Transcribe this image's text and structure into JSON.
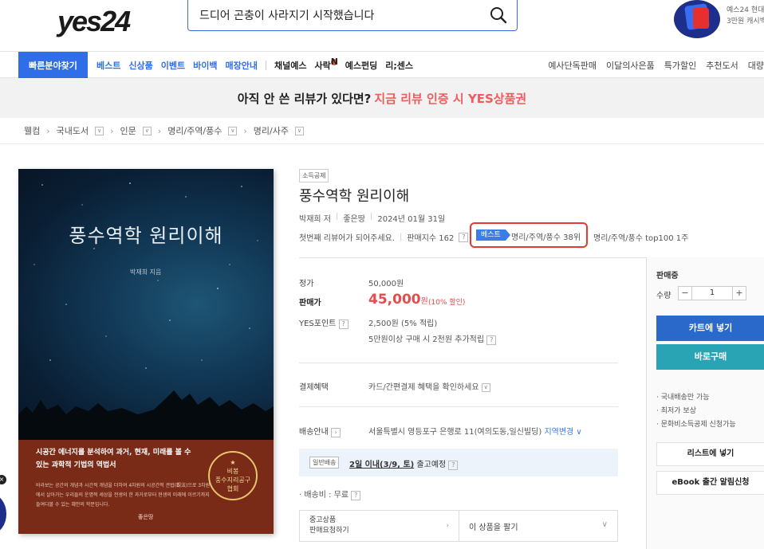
{
  "header": {
    "logo_text": "yes24",
    "search_value": "드디어 곤충이 사라지기 시작했습니다",
    "promo_text_line1": "예스24 현대",
    "promo_text_line2": "3만원 캐시백"
  },
  "nav": {
    "quick_find": "빠른분야찾기",
    "main_items": [
      "베스트",
      "신상품",
      "이벤트",
      "바이백",
      "매장안내"
    ],
    "sub_items": [
      "채널예스",
      "사락",
      "예스펀딩",
      "리;센스"
    ],
    "right_items": [
      "예사단독판매",
      "이달의사은품",
      "특가할인",
      "추천도서",
      "대량"
    ],
    "new_badge": "N"
  },
  "banner": {
    "text": "아직 안 쓴 리뷰가 있다면?",
    "highlight": "지금 리뷰 인증 시 YES상품권"
  },
  "breadcrumb": [
    "웰컴",
    "국내도서",
    "인문",
    "명리/주역/풍수",
    "명리/사주"
  ],
  "cover": {
    "title": "풍수역학 원리이해",
    "author": "박재희 지음",
    "tagline": "시공간 에너지를 분석하여 과거, 현재, 미래를 볼 수 있는 과학적 기법의 역법서",
    "small_text": "바라보는 공간의 개념과 시간적 개념을 더하여 4차원의 시공간적 관법(觀法)으로 3차원에서 살아가는 우리들의 운명적 세상을 전생의 한 과거로부터 현생의 미래에 이르기까지 들여다볼 수 있는 혜안의 학문입니다.",
    "seal_line1": "비봉",
    "seal_line2": "풍수지리공구",
    "seal_line3": "협회",
    "publisher": "좋은땅"
  },
  "product": {
    "income_tag": "소득공제",
    "title": "풍수역학 원리이해",
    "author": "박재희 저",
    "publisher": "좋은땅",
    "date": "2024년 01월 31일",
    "first_reviewer": "첫번째 리뷰어가 되어주세요.",
    "sales_index": "판매지수 162",
    "best_label": "베스트",
    "best_rank": "명리/주역/풍수 38위",
    "top100": "명리/주역/풍수 top100 1주"
  },
  "price": {
    "list_label": "정가",
    "list_value": "50,000원",
    "sale_label": "판매가",
    "sale_value": "45,000",
    "sale_unit": "원",
    "discount": "(10% 할인)",
    "point_label": "YES포인트",
    "point_value": "2,500원 (5% 적립)",
    "point_extra": "5만원이상 구매 시 2천원 추가적립"
  },
  "payment": {
    "label": "결제혜택",
    "value": "카드/간편결제 혜택을 확인하세요"
  },
  "shipping": {
    "label": "배송안내",
    "address": "서울특별시 영등포구 은행로 11(여의도동,일신빌딩)",
    "change_link": "지역변경",
    "tag": "일반배송",
    "eta_link": "2일 이내(3/9, 토)",
    "eta_suffix": "출고예정",
    "fee": "· 배송비 : 무료"
  },
  "used": {
    "left_line1": "중고상품",
    "left_line2": "판매요청하기",
    "right": "이 상품을 팔기"
  },
  "panel": {
    "status": "판매중",
    "qty_label": "수량",
    "qty_value": "1",
    "cart_button": "카트에 넣기",
    "buy_button": "바로구매",
    "bullets": [
      "· 국내배송만 가능",
      "· 최저가 보상",
      "· 문화비소득공제 신청가능"
    ],
    "list_button": "리스트에 넣기",
    "ebook_button": "eBook 출간 알림신청"
  }
}
